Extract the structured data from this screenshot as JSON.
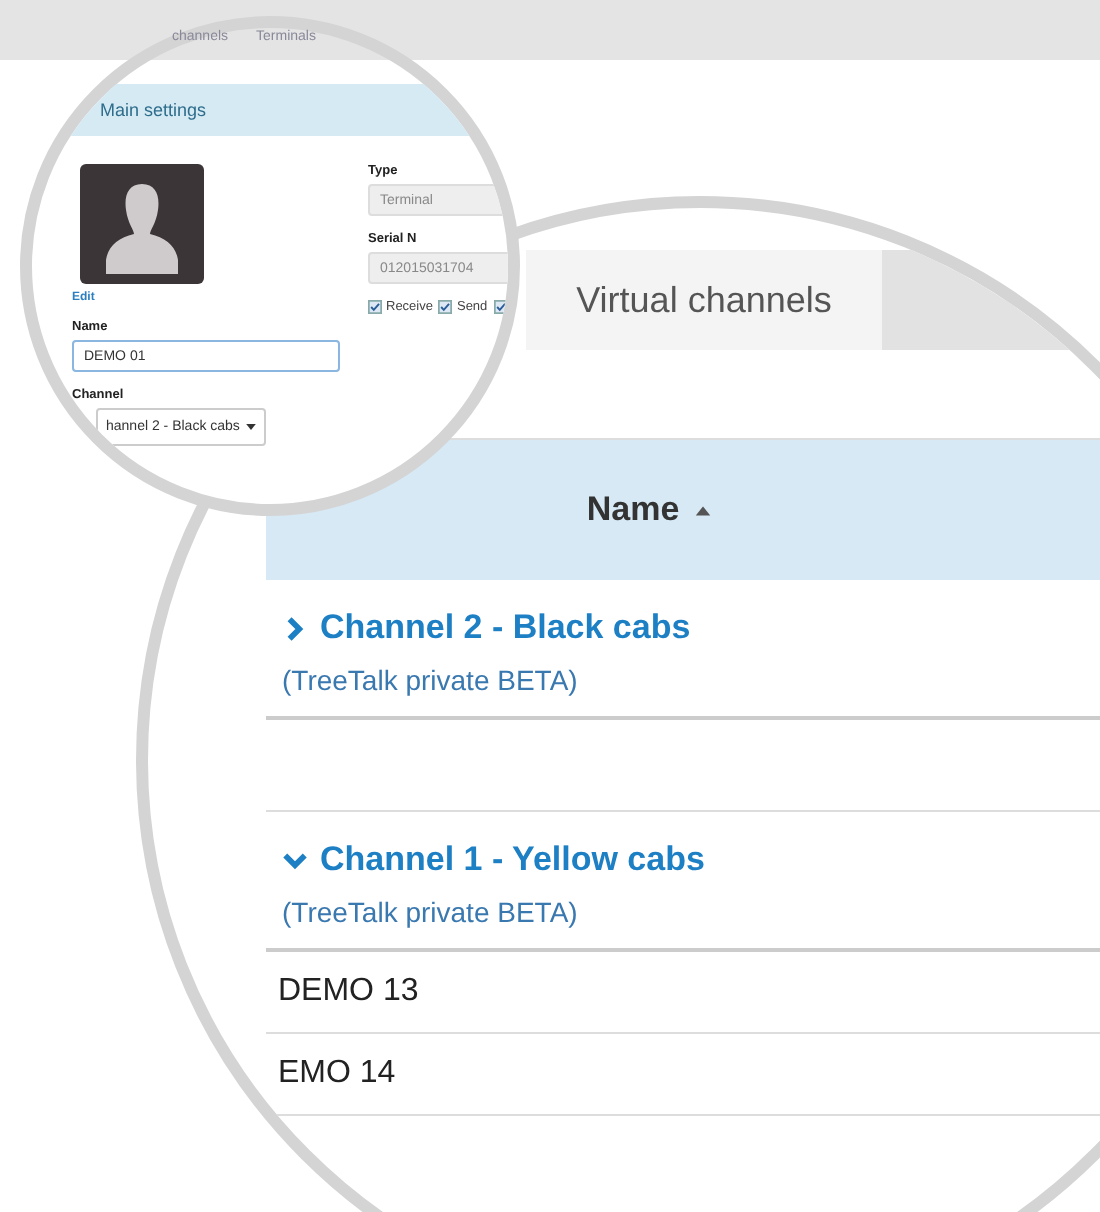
{
  "top_nav": {
    "items": [
      {
        "label": "channels"
      },
      {
        "label": "Terminals"
      }
    ]
  },
  "detail": {
    "header": "Main settings",
    "edit_link": "Edit",
    "name_field": {
      "label": "Name",
      "value": "DEMO 01"
    },
    "channel_select": {
      "label": "Channel",
      "value": "hannel 2 - Black cabs"
    },
    "type_field": {
      "label": "Type",
      "value": "Terminal"
    },
    "serial_field": {
      "label": "Serial N",
      "value": "012015031704"
    },
    "checkboxes": [
      {
        "label": "Receive",
        "checked": true
      },
      {
        "label": "Send",
        "checked": true
      },
      {
        "checked": true
      }
    ]
  },
  "tabs": [
    {
      "label": "Virtual channels",
      "selected": true
    }
  ],
  "table": {
    "column": "Name",
    "rows": [
      {
        "kind": "channel",
        "title": "Channel 2 - Black cabs",
        "subtitle": "(TreeTalk private BETA)",
        "expanded": false
      },
      {
        "kind": "blank"
      },
      {
        "kind": "channel",
        "title": "Channel 1 - Yellow cabs",
        "subtitle": "(TreeTalk private BETA)",
        "expanded": true
      },
      {
        "kind": "terminal",
        "name": "DEMO 13"
      },
      {
        "kind": "terminal",
        "name": "EMO 14"
      }
    ]
  }
}
